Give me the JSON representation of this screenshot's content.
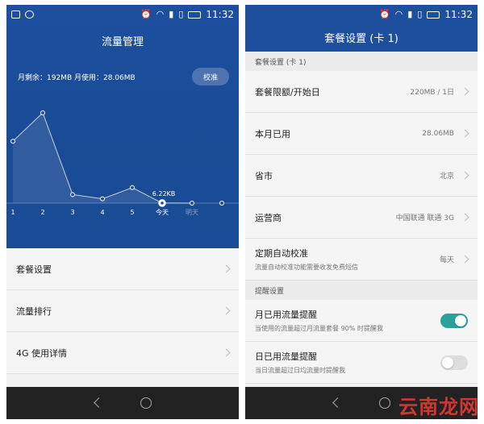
{
  "status_bar": {
    "time": "11:32"
  },
  "left": {
    "title": "流量管理",
    "summary": "月剩余：192MB 月使用：28.06MB",
    "calibrate": "校准",
    "menu": [
      "套餐设置",
      "流量排行",
      "4G 使用详情"
    ]
  },
  "chart_data": {
    "type": "line",
    "categories": [
      "1",
      "2",
      "3",
      "4",
      "5",
      "今天",
      "明天"
    ],
    "values": [
      7.2,
      10.5,
      1.0,
      0.5,
      1.8,
      0.01,
      0.0
    ],
    "annotation": "6.22KB",
    "highlight_index": 5,
    "ylim": [
      0,
      12
    ],
    "grid": false
  },
  "right": {
    "title": "套餐设置 (卡 1)",
    "section1": "套餐设置 (卡 1)",
    "rows": [
      {
        "label": "套餐限额/开始日",
        "value": "220MB / 1日"
      },
      {
        "label": "本月已用",
        "value": "28.06MB"
      },
      {
        "label": "省市",
        "value": "北京"
      },
      {
        "label": "运营商",
        "value": "中国联通 联通 3G"
      },
      {
        "label": "定期自动校准",
        "sub": "流量自动校准功能需要收发免费短信",
        "value": "每天"
      }
    ],
    "section2": "提醒设置",
    "reminders": [
      {
        "label": "月已用流量提醒",
        "sub": "当使用的流量超过月流量套餐 90% 时提醒我",
        "on": true
      },
      {
        "label": "日已用流量提醒",
        "sub": "当日流量超过日均流量时提醒我",
        "on": false
      }
    ]
  },
  "watermark": "云南龙网"
}
